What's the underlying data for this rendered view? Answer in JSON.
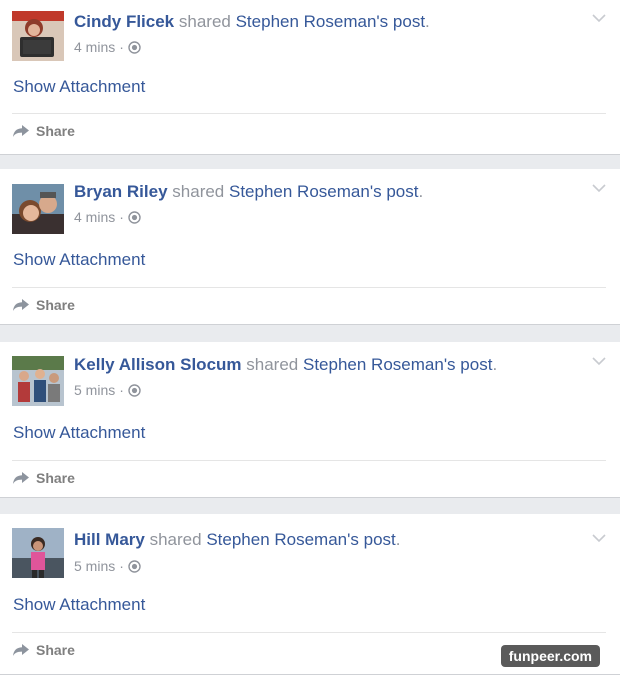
{
  "posts": [
    {
      "author": "Cindy Flicek",
      "shared_text": "shared",
      "original_author": "Stephen Roseman",
      "possessive": "'s",
      "post_link": "post",
      "period": ".",
      "time": "4 mins",
      "dot": "·",
      "attachment_label": "Show Attachment",
      "share_label": "Share"
    },
    {
      "author": "Bryan Riley",
      "shared_text": "shared",
      "original_author": "Stephen Roseman",
      "possessive": "'s",
      "post_link": "post",
      "period": ".",
      "time": "4 mins",
      "dot": "·",
      "attachment_label": "Show Attachment",
      "share_label": "Share"
    },
    {
      "author": "Kelly Allison Slocum",
      "shared_text": "shared",
      "original_author": "Stephen Roseman",
      "possessive": "'s",
      "post_link": "post",
      "period": ".",
      "time": "5 mins",
      "dot": "·",
      "attachment_label": "Show Attachment",
      "share_label": "Share"
    },
    {
      "author": "Hill Mary",
      "shared_text": "shared",
      "original_author": "Stephen Roseman",
      "possessive": "'s",
      "post_link": "post",
      "period": ".",
      "time": "5 mins",
      "dot": "·",
      "attachment_label": "Show Attachment",
      "share_label": "Share"
    }
  ],
  "watermark": "funpeer.com",
  "colors": {
    "link": "#365899",
    "muted": "#90949c",
    "share": "#7f7f7f",
    "background": "#e9ebee"
  },
  "icons": {
    "privacy": "globe-icon",
    "menu": "chevron-down-icon",
    "share": "share-arrow-icon"
  }
}
